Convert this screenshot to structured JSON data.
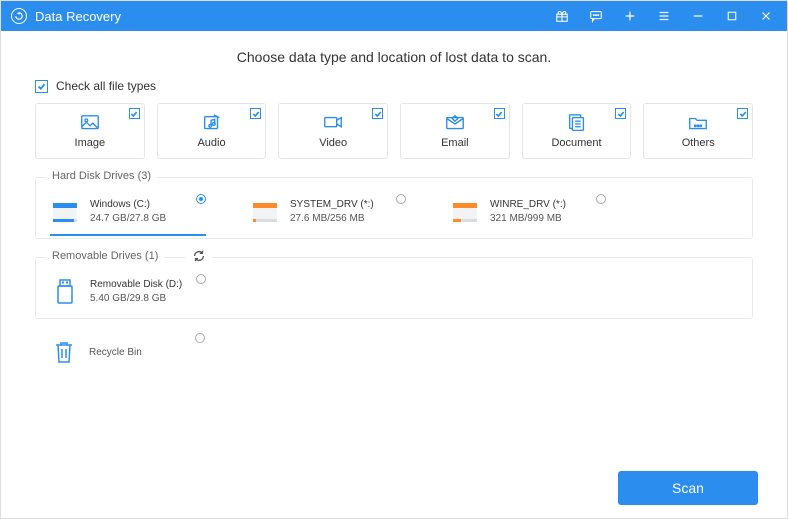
{
  "titlebar": {
    "title": "Data Recovery"
  },
  "heading": "Choose data type and location of lost data to scan.",
  "check_all_label": "Check all file types",
  "types": [
    {
      "label": "Image"
    },
    {
      "label": "Audio"
    },
    {
      "label": "Video"
    },
    {
      "label": "Email"
    },
    {
      "label": "Document"
    },
    {
      "label": "Others"
    }
  ],
  "hdd": {
    "label": "Hard Disk Drives (3)",
    "drives": [
      {
        "name": "Windows (C:)",
        "usage": "24.7 GB/27.8 GB",
        "selected": true,
        "fill": "#2b8eee",
        "used_ratio": 0.89
      },
      {
        "name": "SYSTEM_DRV (*:)",
        "usage": "27.6 MB/256 MB",
        "selected": false,
        "fill": "#ff8a2b",
        "used_ratio": 0.11
      },
      {
        "name": "WINRE_DRV (*:)",
        "usage": "321 MB/999 MB",
        "selected": false,
        "fill": "#ff8a2b",
        "used_ratio": 0.32
      }
    ]
  },
  "removable": {
    "label": "Removable Drives (1)",
    "drives": [
      {
        "name": "Removable Disk (D:)",
        "usage": "5.40 GB/29.8 GB"
      }
    ]
  },
  "recycle_label": "Recycle Bin",
  "scan_label": "Scan"
}
